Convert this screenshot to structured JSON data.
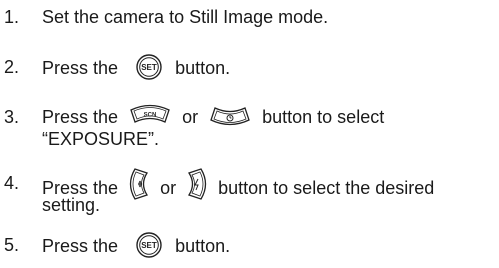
{
  "steps": [
    {
      "number": "1.",
      "text": "Set the camera to Still Image mode."
    },
    {
      "number": "2.",
      "before": "Press the",
      "after": "button.",
      "icon": "set-button-icon",
      "icon_label": "SET"
    },
    {
      "number": "3.",
      "before": "Press the",
      "mid": "or",
      "after": "button to select",
      "line2": "“EXPOSURE”.",
      "icon_a": "scn-up-button-icon",
      "icon_a_label": "SCN",
      "icon_b": "timer-down-button-icon"
    },
    {
      "number": "4.",
      "before": "Press the",
      "mid": "or",
      "after": "button to select the desired",
      "line2": "setting.",
      "icon_a": "macro-left-button-icon",
      "icon_b": "flash-right-button-icon"
    },
    {
      "number": "5.",
      "before": "Press the",
      "after": "button.",
      "icon": "set-button-icon",
      "icon_label": "SET"
    }
  ]
}
